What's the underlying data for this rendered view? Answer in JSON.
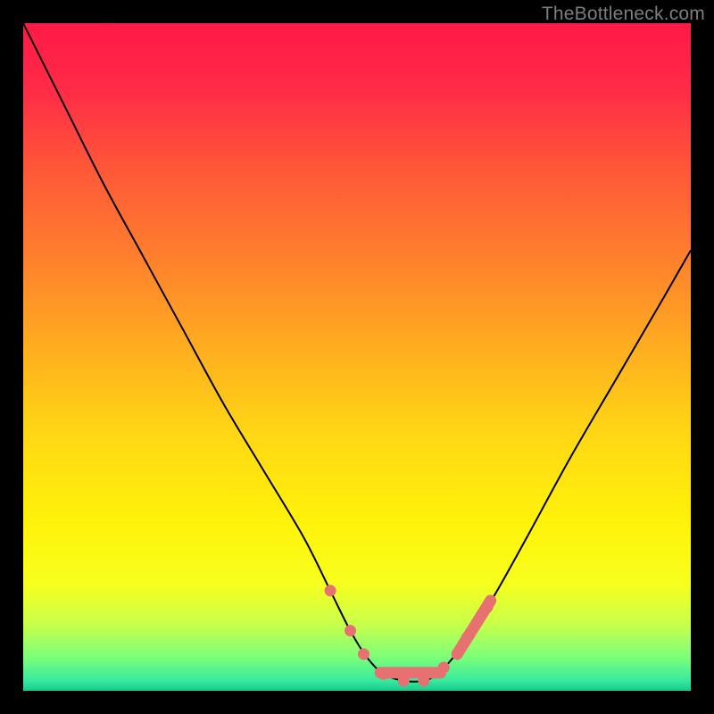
{
  "watermark": "TheBottleneck.com",
  "chart_data": {
    "type": "line",
    "title": "",
    "xlabel": "",
    "ylabel": "",
    "xlim": [
      0,
      100
    ],
    "ylim": [
      0,
      100
    ],
    "gradient_stops": [
      {
        "offset": 0.0,
        "color": "#ff1a47"
      },
      {
        "offset": 0.1,
        "color": "#ff2b47"
      },
      {
        "offset": 0.22,
        "color": "#ff5838"
      },
      {
        "offset": 0.35,
        "color": "#ff7f2d"
      },
      {
        "offset": 0.5,
        "color": "#ffb21e"
      },
      {
        "offset": 0.62,
        "color": "#ffd814"
      },
      {
        "offset": 0.75,
        "color": "#fff30a"
      },
      {
        "offset": 0.84,
        "color": "#f7ff1e"
      },
      {
        "offset": 0.9,
        "color": "#c8ff4a"
      },
      {
        "offset": 0.95,
        "color": "#7bff79"
      },
      {
        "offset": 0.985,
        "color": "#37eaa0"
      },
      {
        "offset": 1.0,
        "color": "#17c98b"
      }
    ],
    "series": [
      {
        "name": "bottleneck-curve",
        "x": [
          0.0,
          6.0,
          12.0,
          18.0,
          24.0,
          30.0,
          36.0,
          42.0,
          46.0,
          49.0,
          51.5,
          54.0,
          57.0,
          60.0,
          62.0,
          64.0,
          67.0,
          71.0,
          76.0,
          82.0,
          89.0,
          96.0,
          100.0
        ],
        "y": [
          100.0,
          88.0,
          76.0,
          65.0,
          54.0,
          43.0,
          33.0,
          23.0,
          15.0,
          9.0,
          5.0,
          2.5,
          1.5,
          1.5,
          2.5,
          4.5,
          8.5,
          15.0,
          24.0,
          35.0,
          47.0,
          59.0,
          66.0
        ]
      }
    ],
    "markers": {
      "name": "highlight-segments",
      "color": "#e77171",
      "points": [
        {
          "x": 46.0,
          "y": 15.0
        },
        {
          "x": 49.0,
          "y": 9.0
        },
        {
          "x": 51.0,
          "y": 5.5
        },
        {
          "x": 54.0,
          "y": 2.5
        },
        {
          "x": 57.0,
          "y": 1.5
        },
        {
          "x": 60.0,
          "y": 1.5
        },
        {
          "x": 63.0,
          "y": 3.5
        },
        {
          "x": 66.5,
          "y": 8.0
        },
        {
          "x": 69.5,
          "y": 12.5
        }
      ],
      "bars": [
        {
          "x1": 53.5,
          "y1": 2.7,
          "x2": 62.5,
          "y2": 2.7
        },
        {
          "x1": 65.0,
          "y1": 5.5,
          "x2": 70.0,
          "y2": 13.5
        }
      ]
    }
  }
}
